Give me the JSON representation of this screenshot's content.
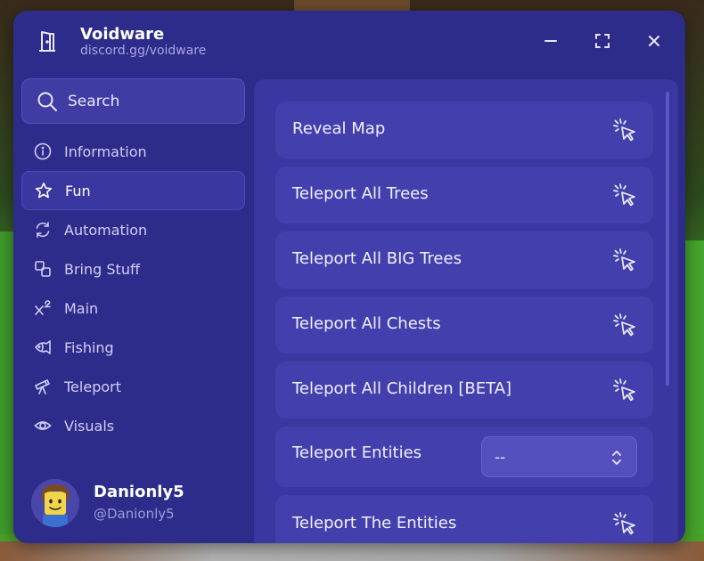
{
  "app": {
    "title": "Voidware",
    "subtitle": "discord.gg/voidware"
  },
  "search": {
    "label": "Search"
  },
  "sidebar": {
    "items": [
      {
        "label": "Information",
        "icon": "info-icon",
        "active": false
      },
      {
        "label": "Fun",
        "icon": "star-icon",
        "active": true
      },
      {
        "label": "Automation",
        "icon": "refresh-icon",
        "active": false
      },
      {
        "label": "Bring Stuff",
        "icon": "copy-icon",
        "active": false
      },
      {
        "label": "Main",
        "icon": "superscript-icon",
        "active": false
      },
      {
        "label": "Fishing",
        "icon": "fish-icon",
        "active": false
      },
      {
        "label": "Teleport",
        "icon": "telescope-icon",
        "active": false
      },
      {
        "label": "Visuals",
        "icon": "eye-icon",
        "active": false
      }
    ]
  },
  "user": {
    "name": "Danionly5",
    "handle": "@Danionly5"
  },
  "main": {
    "rows": [
      {
        "label": "Reveal Map",
        "type": "button"
      },
      {
        "label": "Teleport All Trees",
        "type": "button"
      },
      {
        "label": "Teleport All BIG Trees",
        "type": "button"
      },
      {
        "label": "Teleport All Chests",
        "type": "button"
      },
      {
        "label": "Teleport All Children [BETA]",
        "type": "button"
      },
      {
        "label": "Teleport Entities",
        "type": "dropdown",
        "value": "--"
      },
      {
        "label": "Teleport The Entities",
        "type": "button"
      }
    ]
  },
  "colors": {
    "window": "#2e2c8a",
    "panel": "#3a37a0",
    "row": "#4340ad",
    "accent_text": "#ffffff"
  }
}
